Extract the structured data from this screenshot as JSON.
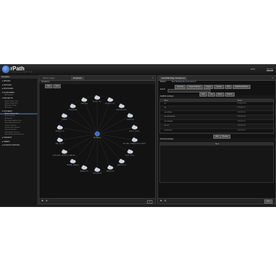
{
  "app": {
    "brand": "rPath",
    "brand_sub": "C O N T R O L   C E N T E R",
    "user": "admin",
    "signout": "Sign Out"
  },
  "sidebar": {
    "header": "Navigation",
    "sections": [
      {
        "label": "▸ IMAGES",
        "subs": []
      },
      {
        "label": "▸ NOTICES",
        "subs": []
      },
      {
        "label": "▸ PACKAGES",
        "subs": []
      },
      {
        "label": "▾ PLATFORMS",
        "subs": [
          "All Platforms"
        ]
      },
      {
        "label": "▾ PROJECTS",
        "subs": [
          "Browse Project Sets",
          "Browse Stage Sets",
          "All Project Stages",
          "All Projects"
        ]
      },
      {
        "label": "▾ SYSTEMS",
        "subs": [
          "Browse System Sets",
          "Active Systems",
          "All Systems",
          "All running appliance sys",
          "All pending update sys",
          "Inactive Systems",
          "Infrastructure Systems",
          "Physical Systems",
          "Web Update Services",
          "Web Windows Build Services"
        ]
      },
      {
        "label": "▸ TARGETS",
        "subs": []
      },
      {
        "label": "▸ USERS",
        "subs": []
      },
      {
        "label": "▸ ACCESS CONTROL",
        "subs": []
      }
    ]
  },
  "left_panel": {
    "tabs": [
      "Platform Images",
      "All Systems"
    ],
    "subheader": "All systems",
    "buttons": [
      "Map",
      "Grid"
    ],
    "center_label": "All Systems",
    "nodes": [
      {
        "label": "RHF-swbg"
      },
      {
        "label": "ubuntu1 - 192..."
      },
      {
        "label": "WinServer - 10..."
      },
      {
        "label": "Fedora-dev 10.0..."
      },
      {
        "label": "centos6-test"
      },
      {
        "label": "rpath-ui - 172.16..."
      },
      {
        "label": "Jboss App - Windows Server 2008 R..."
      },
      {
        "label": "sles11 - 10.0.2..."
      },
      {
        "label": "appliance7-srv"
      },
      {
        "label": "Ad-6b1.5.16"
      },
      {
        "label": "rbm-build-7.dk"
      },
      {
        "label": "Ad-6b1.5.14..."
      },
      {
        "label": "Web-DB - appliance"
      },
      {
        "label": "rpath-update - platform 10 - Appl-Mo..."
      },
      {
        "label": "App - 10.1.1.7"
      },
      {
        "label": "Ad-6b1.5.12-3"
      },
      {
        "label": "build-04"
      },
      {
        "label": "inventory host"
      }
    ]
  },
  "right_panel": {
    "tab": "openSUSE Stage: Development",
    "platform_label": "Platform",
    "platform_value": "Red Hat Enterprise Linux Server 6",
    "buttons": [
      "Summary",
      "Image Definitions",
      "Images",
      "Groups",
      "Edit",
      "Build Now Release"
    ],
    "search_label": "Search",
    "view_buttons": [
      "Map",
      "List",
      "Extra",
      "Search"
    ],
    "available_title": "Available packages",
    "columns": [
      "Name",
      "Version"
    ],
    "packages": [
      {
        "name": "acl",
        "version": "2.2.49-1-1.1.0"
      },
      {
        "name": "apr",
        "version": "1.3.9-3-1.1.1"
      },
      {
        "name": "apr-util-ldap",
        "version": "1.3.9-3-1.1.0"
      },
      {
        "name": "apr-util-openldap",
        "version": "1.3.9-3-1.1.0"
      },
      {
        "name": "apr-util-pgsql",
        "version": "1.3.9-3-1.1.0"
      },
      {
        "name": "apr-util",
        "version": "1.3.9-3-1.1.0"
      },
      {
        "name": "apr-devtools",
        "version": "1.3.9-3-1.1.0"
      }
    ],
    "selected_title": "Selected packages",
    "selected_column": "Name",
    "add_button": "Add",
    "remove_button": "Remove",
    "save_button": "Save"
  },
  "colors": {
    "background": "#1e1e1e",
    "accent": "#3b4f6d",
    "node": "#cfd4dc",
    "center_node": "#2f6fd1"
  },
  "icons": [
    "logo-icon",
    "cloud-node-icon",
    "add-icon",
    "settings-icon",
    "close-icon"
  ]
}
